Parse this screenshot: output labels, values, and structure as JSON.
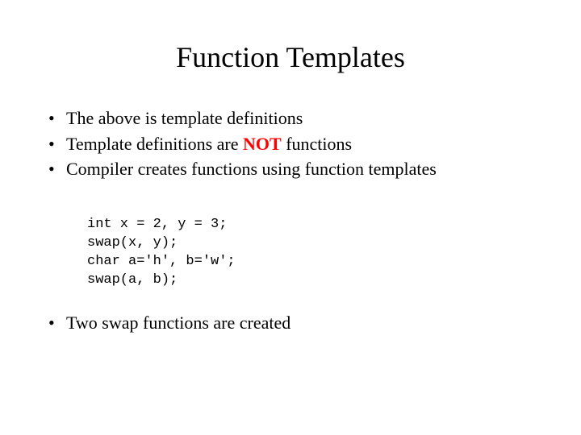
{
  "title": "Function Templates",
  "bullets": [
    {
      "text": "The above is template definitions"
    },
    {
      "pre": "Template definitions are ",
      "emph": "NOT",
      "post": " functions"
    },
    {
      "text": "Compiler creates functions using function templates"
    }
  ],
  "code": {
    "line1": "int x = 2, y = 3;",
    "line2": "swap(x, y);",
    "line3": "char a='h', b='w';",
    "line4": "swap(a, b);"
  },
  "last_bullet": "Two swap functions are created"
}
